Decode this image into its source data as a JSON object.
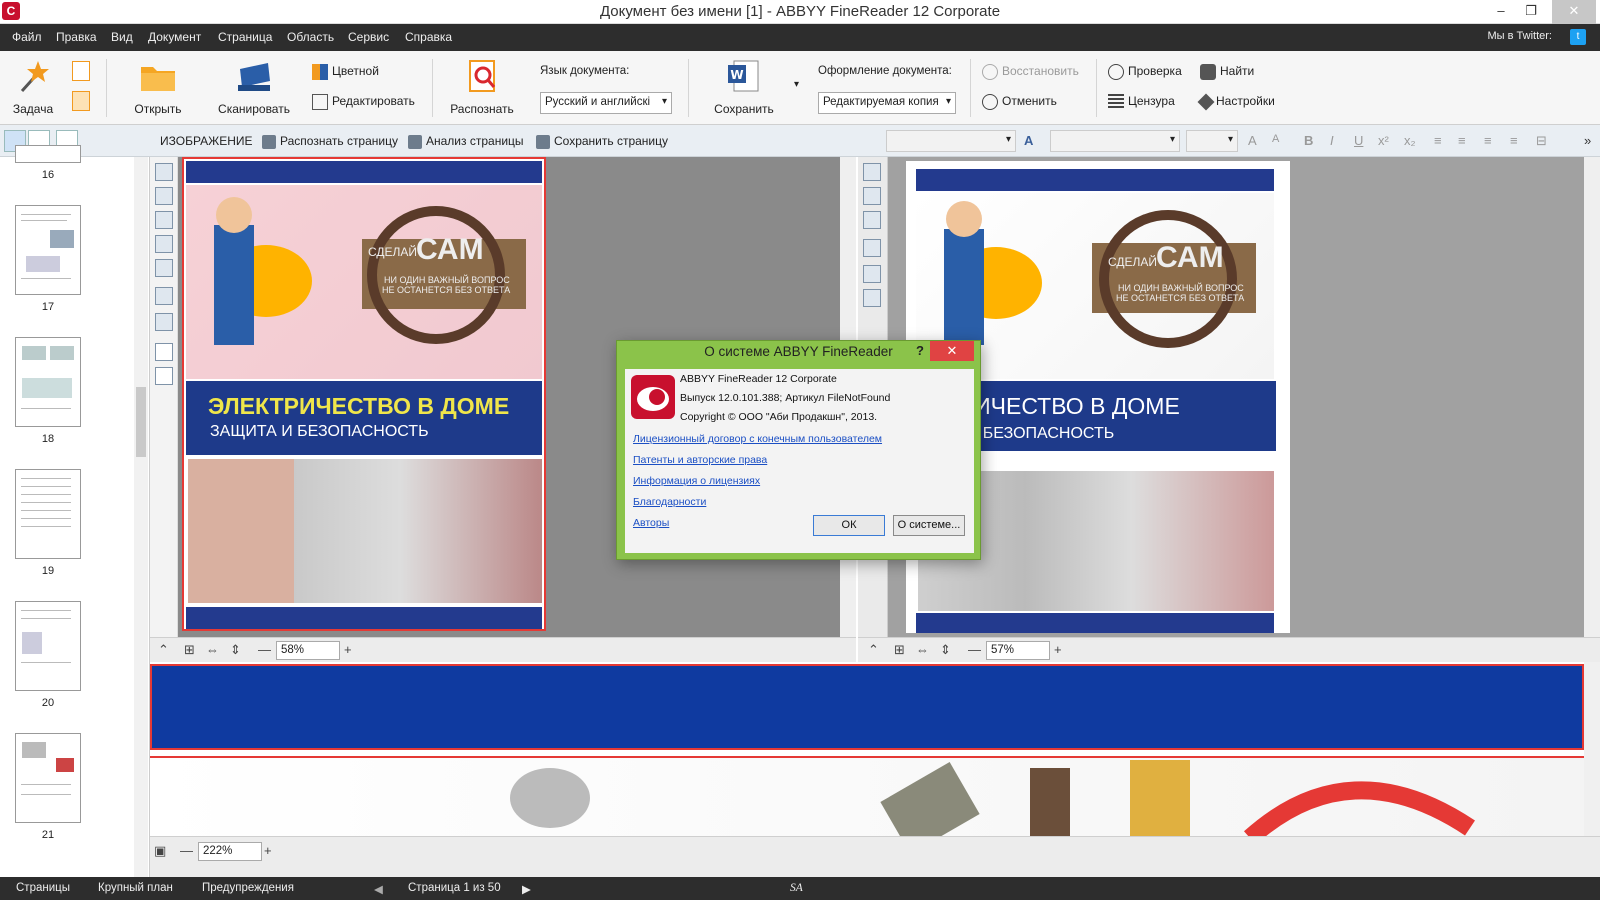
{
  "window": {
    "title": "Документ без имени [1] - ABBYY FineReader 12 Corporate",
    "min": "–",
    "max": "❐",
    "close": "✕"
  },
  "menu": [
    "Файл",
    "Правка",
    "Вид",
    "Документ",
    "Страница",
    "Область",
    "Сервис",
    "Справка"
  ],
  "twitter": {
    "label": "Мы в Twitter:"
  },
  "toolbar": {
    "task": "Задача",
    "open": "Открыть",
    "scan": "Сканировать",
    "color": "Цветной",
    "edit": "Редактировать",
    "recognize": "Распознать",
    "doc_lang_label": "Язык документа:",
    "doc_lang_value": "Русский и английскі",
    "save": "Сохранить",
    "doc_format_label": "Оформление документа:",
    "doc_format_value": "Редактируемая копия",
    "restore": "Восстановить",
    "undo": "Отменить",
    "check": "Проверка",
    "censor": "Цензура",
    "find": "Найти",
    "settings": "Настройки"
  },
  "row2": {
    "image_label": "ИЗОБРАЖЕНИЕ",
    "recognize_page": "Распознать страницу",
    "analyze_page": "Анализ страницы",
    "save_page": "Сохранить страницу"
  },
  "thumbnails": [
    {
      "num": "16"
    },
    {
      "num": "17"
    },
    {
      "num": "18"
    },
    {
      "num": "19"
    },
    {
      "num": "20"
    },
    {
      "num": "21"
    }
  ],
  "page_content": {
    "banner_small": "СДЕЛАЙ",
    "banner_big": "САМ",
    "banner_sub1": "НИ ОДИН ВАЖНЫЙ ВОПРОС",
    "banner_sub2": "НЕ ОСТАНЕТСЯ БЕЗ ОТВЕТА",
    "headline": "ЭЛЕКТРИЧЕСТВО В ДОМЕ",
    "subhead": "ЗАЩИТА И БЕЗОПАСНОСТЬ",
    "headline_text": "ЕКТРИЧЕСТВО В ДОМЕ",
    "subhead_text": "ЩИТА И БЕЗОПАСНОСТЬ"
  },
  "zoom": {
    "image": "58%",
    "text": "57%",
    "closeup": "222%"
  },
  "status": {
    "pages": "Страницы",
    "closeup": "Крупный план",
    "warnings": "Предупреждения",
    "page_info": "Страница 1 из 50",
    "brand": "SA"
  },
  "dialog": {
    "title": "О системе ABBYY FineReader",
    "help": "?",
    "close": "✕",
    "product": "ABBYY FineReader 12 Corporate",
    "build": "Выпуск 12.0.101.388; Артикул FileNotFound",
    "copyright": "Copyright © ООО \"Аби Продакшн\", 2013.",
    "links": [
      "Лицензионный договор с конечным пользователем",
      "Патенты и авторские права",
      "Информация о лицензиях",
      "Благодарности",
      "Авторы"
    ],
    "ok": "ОК",
    "about": "О системе..."
  },
  "colors": {
    "accent": "#8bc34a",
    "band": "#233a8e",
    "headline": "#f0e64a",
    "error": "#e53935"
  }
}
